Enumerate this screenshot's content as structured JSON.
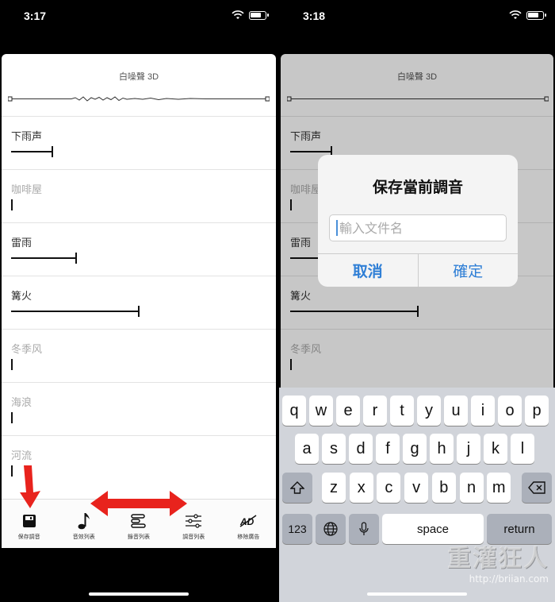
{
  "left_phone": {
    "status_time": "3:17",
    "card_title": "白噪聲 3D",
    "sounds": [
      {
        "name": "下雨声",
        "level": 0.26,
        "dim": false
      },
      {
        "name": "咖啡屋",
        "level": 0.0,
        "dim": true
      },
      {
        "name": "雷雨",
        "level": 0.41,
        "dim": false
      },
      {
        "name": "篝火",
        "level": 0.81,
        "dim": false
      },
      {
        "name": "冬季风",
        "level": 0.0,
        "dim": true
      },
      {
        "name": "海浪",
        "level": 0.0,
        "dim": true
      },
      {
        "name": "河流",
        "level": 0.0,
        "dim": true
      }
    ],
    "tabs": [
      {
        "label": "保存調音",
        "icon": "save-icon"
      },
      {
        "label": "音效列表",
        "icon": "music-note-icon"
      },
      {
        "label": "錄音列表",
        "icon": "recordings-list-icon"
      },
      {
        "label": "調音列表",
        "icon": "sliders-icon"
      },
      {
        "label": "移除廣告",
        "icon": "no-ads-icon"
      }
    ],
    "annotation_color": "#e8231d"
  },
  "right_phone": {
    "status_time": "3:18",
    "card_title": "白噪聲 3D",
    "sounds": [
      {
        "name": "下雨声",
        "level": 0.26,
        "dim": false
      },
      {
        "name": "咖啡屋",
        "level": 0.0,
        "dim": true
      },
      {
        "name": "雷雨",
        "level": 0.41,
        "dim": false
      },
      {
        "name": "篝火",
        "level": 0.81,
        "dim": false
      },
      {
        "name": "冬季风",
        "level": 0.0,
        "dim": true
      }
    ],
    "dialog": {
      "title": "保存當前調音",
      "input_placeholder": "輸入文件名",
      "input_value": "",
      "cancel_label": "取消",
      "confirm_label": "確定"
    },
    "keyboard": {
      "row1": [
        "q",
        "w",
        "e",
        "r",
        "t",
        "y",
        "u",
        "i",
        "o",
        "p"
      ],
      "row2": [
        "a",
        "s",
        "d",
        "f",
        "g",
        "h",
        "j",
        "k",
        "l"
      ],
      "row3": [
        "z",
        "x",
        "c",
        "v",
        "b",
        "n",
        "m"
      ],
      "numbers_label": "123",
      "space_label": "space",
      "return_label": "return"
    }
  },
  "watermark": {
    "logo": "重灌狂人",
    "url": "http://briian.com"
  },
  "accent_blue": "#2f7fd6"
}
